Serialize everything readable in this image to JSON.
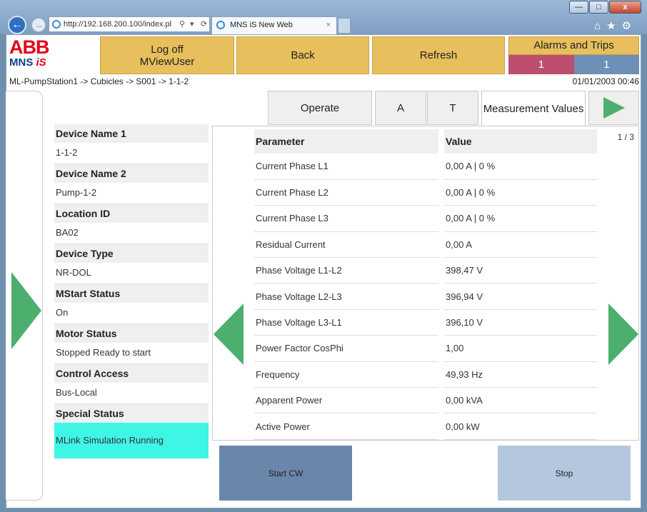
{
  "browser": {
    "url": "http://192.168.200.100/index.pl",
    "tab_title": "MNS iS New Web",
    "tab_close": "×",
    "win_min": "—",
    "win_max": "□",
    "win_close": "x",
    "tools": "⌂★⚙",
    "addr_search_icon": "⚲",
    "addr_dropdown_icon": "▾",
    "addr_refresh_icon": "⟳"
  },
  "logo": {
    "abb": "ABB",
    "mns": "MNS",
    "is": "iS"
  },
  "header": {
    "logoff_line1": "Log off",
    "logoff_line2": "MViewUser",
    "back_label": "Back",
    "refresh_label": "Refresh",
    "alarms_title": "Alarms and Trips",
    "alarm_count": "1",
    "trip_count": "1"
  },
  "breadcrumb": "ML-PumpStation1 -> Cubicles -> S001 -> 1-1-2",
  "datetime": "01/01/2003 00:46",
  "tabs": {
    "operate": "Operate",
    "a": "A",
    "t": "T",
    "measurement": "Measurement Values"
  },
  "device": [
    {
      "label": "Device Name 1",
      "value": "1-1-2"
    },
    {
      "label": "Device Name 2",
      "value": "Pump-1-2"
    },
    {
      "label": "Location ID",
      "value": "BA02"
    },
    {
      "label": "Device Type",
      "value": "NR-DOL"
    },
    {
      "label": "MStart Status",
      "value": "On"
    },
    {
      "label": "Motor Status",
      "value": "Stopped Ready to start"
    },
    {
      "label": "Control Access",
      "value": "Bus-Local"
    },
    {
      "label": "Special Status",
      "value": "MLink Simulation Running"
    }
  ],
  "table": {
    "page_indicator": "1 / 3",
    "col_parameter": "Parameter",
    "col_value": "Value",
    "rows": [
      {
        "param": "Current Phase L1",
        "value": "0,00 A | 0 %"
      },
      {
        "param": "Current Phase L2",
        "value": "0,00 A | 0 %"
      },
      {
        "param": "Current Phase L3",
        "value": "0,00 A | 0 %"
      },
      {
        "param": "Residual Current",
        "value": "0,00 A"
      },
      {
        "param": "Phase Voltage L1-L2",
        "value": "398,47 V"
      },
      {
        "param": "Phase Voltage L2-L3",
        "value": "396,94 V"
      },
      {
        "param": "Phase Voltage L3-L1",
        "value": "396,10 V"
      },
      {
        "param": "Power Factor CosPhi",
        "value": "1,00"
      },
      {
        "param": "Frequency",
        "value": "49,93 Hz"
      },
      {
        "param": "Apparent Power",
        "value": "0,00 kVA"
      },
      {
        "param": "Active Power",
        "value": "0,00 kW"
      }
    ]
  },
  "commands": {
    "start_cw": "Start CW",
    "stop": "Stop"
  },
  "colors": {
    "header_button": "#e7bf5d",
    "alarm": "#bd4e6f",
    "trip": "#6e8fb6",
    "arrow": "#4caf6e",
    "special_status": "#3ff5e6",
    "start_cw": "#6a87ab",
    "stop": "#b5c7de"
  }
}
